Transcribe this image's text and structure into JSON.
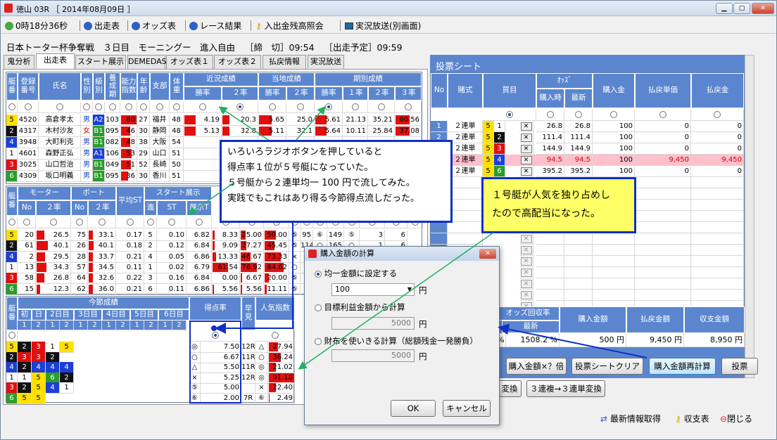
{
  "window": {
    "title": "徳山 03R ［ 2014年08月09日 ］",
    "min": "▁",
    "max": "▢",
    "close": "✕"
  },
  "toolbar": {
    "timer": "0時18分36秒",
    "entry": "出走表",
    "odds": "オッズ表",
    "result": "レース結果",
    "deposit": "入出金残高照会",
    "live": "実況放送(別画面)"
  },
  "race": {
    "name": "日本トーター杯争奪戦　３日目　モーニングー　進入自由",
    "close": "［締　切］09:54",
    "start": "［出走予定］09:59"
  },
  "tabs": [
    "鬼分析",
    "出走表",
    "スタート展示",
    "DEMEDAS",
    "オッズ表１",
    "オッズ表２",
    "払戻情報",
    "実況放送"
  ],
  "t1": {
    "headers": {
      "waku": "艇番",
      "reg": "登録番号",
      "name": "氏名",
      "sex": "性別",
      "cls": "級別",
      "weight_age": "養成期",
      "ability": "能力指数",
      "age": "年齢",
      "branch": "支部",
      "wt": "体重",
      "recent": "近況成績",
      "local": "当地成績",
      "term": "期別成績",
      "win": "勝率",
      "q2": "２率",
      "q1": "１率",
      "q3": "３率"
    },
    "rows": [
      {
        "w": "5",
        "reg": "4520",
        "name": "高倉孝太",
        "sex": "男",
        "cls": "A2",
        "a": "103",
        "b": "80",
        "age": "27",
        "br": "福井",
        "wt": "48",
        "r1": "4.19",
        "r2": "20.3",
        "l1": "5.65",
        "l2": "25.0",
        "t1": "5.61",
        "t2": "21.13",
        "t3": "35.21",
        "t4": "60.56"
      },
      {
        "w": "2",
        "reg": "4317",
        "name": "木村沙友",
        "sex": "女",
        "cls": "B1",
        "a": "095",
        "b": "46",
        "age": "30",
        "br": "静岡",
        "wt": "48",
        "r1": "5.13",
        "r2": "32.8",
        "l1": "5.11",
        "l2": "32.1",
        "t1": "5.64",
        "t2": "10.11",
        "t3": "25.84",
        "t4": "37.08"
      },
      {
        "w": "4",
        "reg": "3948",
        "name": "大町利克",
        "sex": "男",
        "cls": "B1",
        "a": "082",
        "b": "48",
        "age": "38",
        "br": "大阪",
        "wt": "54",
        "r1": "",
        "r2": "",
        "l1": "",
        "l2": "",
        "t1": "",
        "t2": "",
        "t3": "",
        "t4": ""
      },
      {
        "w": "1",
        "reg": "4601",
        "name": "森野正弘",
        "sex": "男",
        "cls": "A1",
        "a": "106",
        "b": "53",
        "age": "29",
        "br": "山口",
        "wt": "51",
        "r1": "",
        "r2": "",
        "l1": "",
        "l2": "",
        "t1": "",
        "t2": "",
        "t3": "",
        "t4": ""
      },
      {
        "w": "3",
        "reg": "3025",
        "name": "山口哲治",
        "sex": "男",
        "cls": "B1",
        "a": "049",
        "b": "51",
        "age": "52",
        "br": "長崎",
        "wt": "50",
        "r1": "",
        "r2": "",
        "l1": "",
        "l2": "",
        "t1": "",
        "t2": "",
        "t3": "",
        "t4": ""
      },
      {
        "w": "6",
        "reg": "4309",
        "name": "坂口明義",
        "sex": "男",
        "cls": "B1",
        "a": "095",
        "b": "36",
        "age": "30",
        "br": "香川",
        "wt": "51",
        "r1": "",
        "r2": "",
        "l1": "",
        "l2": "",
        "t1": "",
        "t2": "",
        "t3": "",
        "t4": ""
      }
    ]
  },
  "t2": {
    "headers": {
      "waku": "艇番",
      "motor": "モーター",
      "boat": "ボート",
      "avgst": "平均ST",
      "st_show": "スタート展示",
      "no": "No",
      "q2": "２率",
      "ren": "進",
      "st": "ST",
      "show": "展示T"
    },
    "rows": [
      {
        "w": "5",
        "mn": "20",
        "mq": "26.5",
        "bn": "75",
        "bq": "33.1",
        "avg": "0.17",
        "ren": "5",
        "st": "0.10",
        "ten": "6.82",
        "x1": "8.33",
        "x2": "25.00",
        "x3": "50.00",
        "mk": "⑤",
        "y1": "95",
        "y2": "⑥",
        "y3": "149",
        "y4": "⑤",
        "y5": "3",
        "y6": "6"
      },
      {
        "w": "2",
        "mn": "61",
        "mq": "40.1",
        "bn": "26",
        "bq": "40.1",
        "avg": "0.18",
        "ren": "2",
        "st": "0.12",
        "ten": "6.84",
        "x1": "9.09",
        "x2": "27.27",
        "x3": "45.45",
        "mk": "⑤",
        "y1": "114",
        "y2": "○",
        "y3": "165",
        "y4": "○",
        "y5": "1",
        "y6": "6"
      },
      {
        "w": "4",
        "mn": "2",
        "mq": "29.5",
        "bn": "28",
        "bq": "33.7",
        "avg": "0.21",
        "ren": "4",
        "st": "0.05",
        "ten": "6.86",
        "x1": "13.33",
        "x2": "46.67",
        "x3": "73.33",
        "mk": "×",
        "y1": "",
        "y2": "",
        "y3": "",
        "y4": "",
        "y5": "",
        "y6": ""
      },
      {
        "w": "1",
        "mn": "13",
        "mq": "34.3",
        "bn": "57",
        "bq": "34.5",
        "avg": "0.11",
        "ren": "1",
        "st": "0.02",
        "ten": "6.79",
        "x1": "61.54",
        "x2": "76.92",
        "x3": "84.62",
        "mk": "○",
        "y1": "",
        "y2": "",
        "y3": "",
        "y4": "",
        "y5": "",
        "y6": ""
      },
      {
        "w": "3",
        "mn": "58",
        "mq": "26.8",
        "bn": "64",
        "bq": "32.6",
        "avg": "0.22",
        "ren": "3",
        "st": "0.16",
        "ten": "6.84",
        "x1": "0.00",
        "x2": "6.67",
        "x3": "20.00",
        "mk": "⑤",
        "y1": "",
        "y2": "",
        "y3": "",
        "y4": "",
        "y5": "",
        "y6": ""
      },
      {
        "w": "6",
        "mn": "15",
        "mq": "12.3",
        "bn": "62",
        "bq": "36.0",
        "avg": "0.21",
        "ren": "6",
        "st": "0.11",
        "ten": "6.86",
        "x1": "5.56",
        "x2": "5.56",
        "x3": "11.11",
        "mk": "⑤",
        "y1": "",
        "y2": "",
        "y3": "",
        "y4": "",
        "y5": "",
        "y6": ""
      }
    ]
  },
  "t3": {
    "headers": {
      "waku": "艇番",
      "term": "今節成績",
      "d1": "初",
      "day": "日",
      "d2": "2日目",
      "d3": "3日目",
      "d4": "4日目",
      "d5": "5日目",
      "d6": "6日目",
      "score": "得点率",
      "early": "早見",
      "pop": "人気指数"
    },
    "nums": [
      "1",
      "2",
      "1",
      "2",
      "1",
      "2",
      "1",
      "2",
      "1",
      "2",
      "1",
      "2"
    ],
    "rows": [
      {
        "w": "5",
        "p": [
          "2",
          "3",
          "1",
          "5"
        ],
        "m": "◎",
        "sc": "7.50",
        "er": "12R",
        "em": "△",
        "pv": "27.94",
        "pb": 34
      },
      {
        "w": "2",
        "p": [
          "3",
          "3",
          "2"
        ],
        "m": "○",
        "sc": "6.67",
        "er": "11R",
        "em": "○",
        "pv": "36.24",
        "pb": 45
      },
      {
        "w": "4",
        "p": [
          "2",
          "4",
          "4",
          "4"
        ],
        "m": "△",
        "sc": "5.50",
        "er": "11R",
        "em": "◎",
        "pv": "21.02",
        "pb": 26
      },
      {
        "w": "1",
        "p": [
          "1",
          "5",
          "6",
          "2"
        ],
        "m": "×",
        "sc": "5.25",
        "er": "12R",
        "em": "◎",
        "pv": "91.18",
        "pb": 100
      },
      {
        "w": "3",
        "p": [
          "2",
          "5",
          "4",
          "1"
        ],
        "m": "⑤",
        "sc": "5.00",
        "er": "",
        "em": "×",
        "pv": "22.40",
        "pb": 28
      },
      {
        "w": "6",
        "p": [
          "5",
          "5"
        ],
        "m": "⑥",
        "sc": "2.00",
        "er": "7R",
        "em": "⑥",
        "pv": "2.49",
        "pb": 3
      }
    ]
  },
  "sheet": {
    "title": "投票シート",
    "headers": {
      "no": "No",
      "kind": "賭式",
      "combo": "買目",
      "odds": "ｵｯｽﾞ",
      "at_buy": "購入時",
      "latest": "最新",
      "amount": "購入金",
      "unit": "払戻単価",
      "payout": "払戻金"
    },
    "rows": [
      {
        "no": "1",
        "k": "２連単",
        "a": "5",
        "b": "1",
        "o1": "26.8",
        "o2": "26.8",
        "amt": "100",
        "u": "0",
        "p": "0",
        "hl": false
      },
      {
        "no": "2",
        "k": "２連単",
        "a": "5",
        "b": "2",
        "o1": "111.4",
        "o2": "111.4",
        "amt": "100",
        "u": "0",
        "p": "0",
        "hl": false
      },
      {
        "no": "3",
        "k": "２連単",
        "a": "5",
        "b": "3",
        "o1": "144.9",
        "o2": "144.9",
        "amt": "100",
        "u": "0",
        "p": "0",
        "hl": false
      },
      {
        "no": "4",
        "k": "２連単",
        "a": "5",
        "b": "4",
        "o1": "94.5",
        "o2": "94.5",
        "amt": "100",
        "u": "9,450",
        "p": "9,450",
        "hl": true
      },
      {
        "no": "5",
        "k": "２連単",
        "a": "5",
        "b": "6",
        "o1": "395.2",
        "o2": "395.2",
        "amt": "100",
        "u": "0",
        "p": "0",
        "hl": false
      }
    ],
    "del": "✕",
    "summary": {
      "odds_rate": "オッズ回収率",
      "latest": "最新",
      "buy": "購入金額",
      "pay": "払戻金額",
      "net": "収支金額",
      "pct": "%",
      "rate": "1508.2 %",
      "buy_v": "500 円",
      "pay_v": "9,450 円",
      "net_v": "8,950 円"
    },
    "btns": {
      "mult": "購入金額×？倍",
      "clear": "投票シートクリア",
      "recalc": "購入金額再計算",
      "vote": "投票",
      "conv1": "変換",
      "conv2": "３連複→３連単変換"
    }
  },
  "dialog": {
    "title": "購入金額の計算",
    "opt1": "均一金額に設定する",
    "amount": "100",
    "yen": "円",
    "opt2": "目標利益金額から計算",
    "v2": "5000",
    "opt3": "財布を使いきる計算（総額残金一発勝負）",
    "v3": "5000",
    "ok": "OK",
    "cancel": "キャンセル"
  },
  "callout1": {
    "l1": "いろいろラジオボタンを押していると",
    "l2": "得点率１位が５号艇になっていた。",
    "l3": "５号艇から２連単均一 100 円で流してみた。",
    "l4": "実践でもこれはあり得る今節得点流しだった。"
  },
  "callout2": {
    "l1": "１号艇が人気を独り占めし",
    "l2": "たので高配当になった。"
  },
  "footer": {
    "refresh": "最新情報取得",
    "balance": "収支表",
    "close": "閉じる"
  }
}
